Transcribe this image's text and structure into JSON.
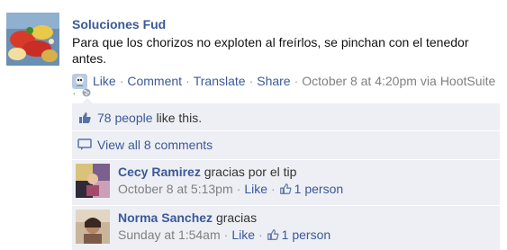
{
  "post": {
    "author": "Soluciones Fud",
    "text": "Para que los chorizos no exploten al freírlos, se pinchan con el tenedor antes.",
    "actions": {
      "like": "Like",
      "comment": "Comment",
      "translate": "Translate",
      "share": "Share",
      "timestamp": "October 8 at 4:20pm",
      "via_prefix": "via",
      "via_app": "HootSuite"
    }
  },
  "ufi": {
    "likes_link": "78 people",
    "likes_suffix": "like this.",
    "view_comments": "View all 8 comments"
  },
  "comments": [
    {
      "name": "Cecy Ramirez",
      "text": "gracias por el tip",
      "time": "October 8 at 5:13pm",
      "like": "Like",
      "likes": "1 person"
    },
    {
      "name": "Norma Sanchez",
      "text": "gracias",
      "time": "Sunday at 1:54am",
      "like": "Like",
      "likes": "1 person"
    }
  ],
  "colors": {
    "link": "#3b5998",
    "meta": "#808080",
    "ufi_bg": "#edeff4"
  }
}
